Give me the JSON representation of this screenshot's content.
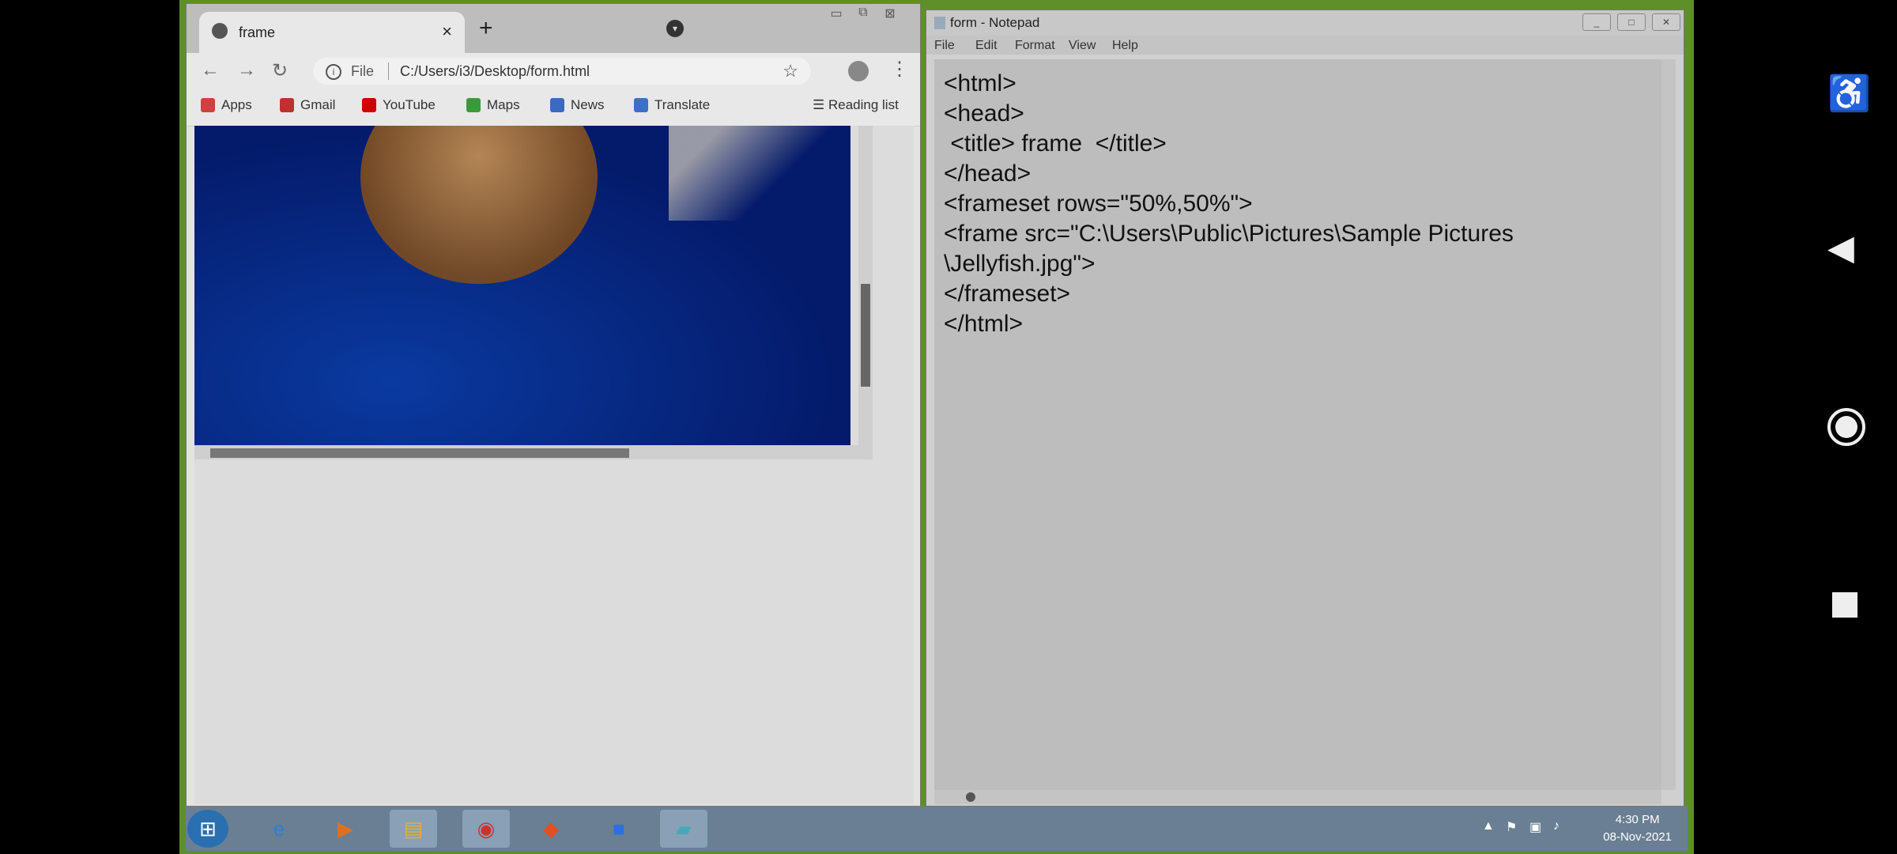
{
  "chrome": {
    "tab_title": "frame",
    "tab_close": "×",
    "new_tab": "+",
    "file_label": "File",
    "url": "C:/Users/i3/Desktop/form.html",
    "bookmarks": [
      {
        "label": "Apps"
      },
      {
        "label": "Gmail"
      },
      {
        "label": "YouTube"
      },
      {
        "label": "Maps"
      },
      {
        "label": "News"
      },
      {
        "label": "Translate"
      }
    ],
    "reading_list": "Reading list"
  },
  "notepad": {
    "title": "form - Notepad",
    "menu": [
      "File",
      "Edit",
      "Format",
      "View",
      "Help"
    ],
    "lines": [
      "<html>",
      "<head>",
      " <title> frame  </title>",
      "</head>",
      "<frameset rows=\"50%,50%\">",
      "<frame src=\"C:\\Users\\Public\\Pictures\\Sample Pictures",
      "\\Jellyfish.jpg\">",
      "</frameset>",
      "</html>"
    ]
  },
  "taskbar": {
    "time": "4:30 PM",
    "date": "08-Nov-2021"
  },
  "colors": {
    "desktop": "#5f8f28",
    "frame_bg": "#041a6a",
    "taskbar": "#6a7f93"
  }
}
